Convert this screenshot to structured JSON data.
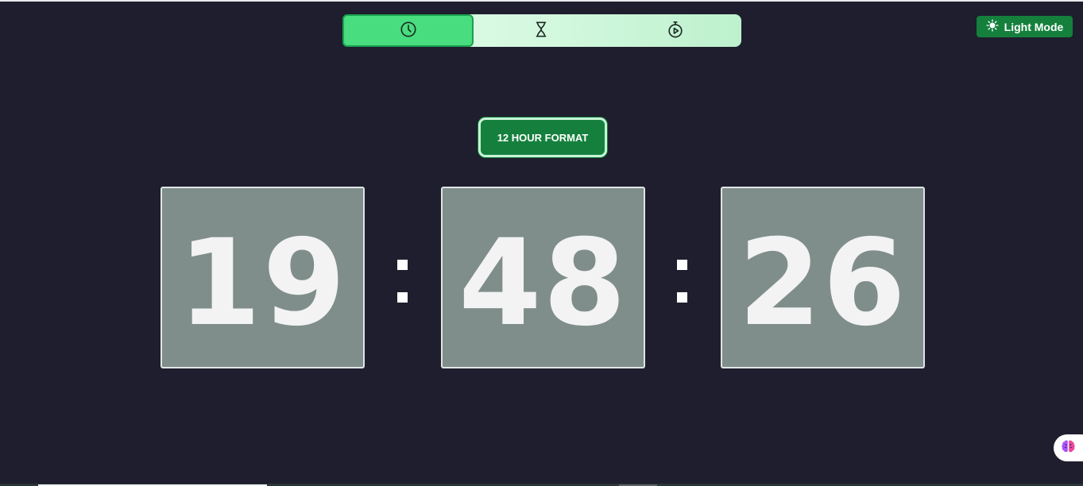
{
  "mode_tabs": [
    {
      "icon": "clock-icon",
      "active": true
    },
    {
      "icon": "hourglass-icon",
      "active": false
    },
    {
      "icon": "stopwatch-icon",
      "active": false
    }
  ],
  "theme_toggle": {
    "label": "Light Mode",
    "icon": "sun-icon"
  },
  "format_toggle": {
    "label": "12 HOUR FORMAT"
  },
  "clock": {
    "hours": "19",
    "minutes": "48",
    "seconds": "26",
    "separator": ":"
  },
  "colors": {
    "background": "#1f1e2e",
    "accent": "#15803d",
    "active_tab": "#48dd7f",
    "digit_box": "#7f8e8b"
  }
}
